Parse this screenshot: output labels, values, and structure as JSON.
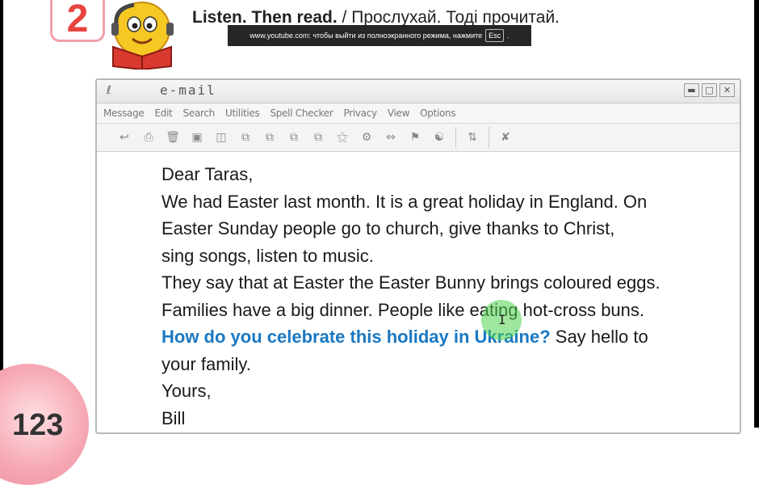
{
  "task": {
    "number": "2",
    "title_en": "Listen. Then read.",
    "separator": "/",
    "title_ua": "Прослухай. Тоді прочитай."
  },
  "toast": {
    "text_before": "www.youtube.com: чтобы выйти из полноэкранного режима, нажмите",
    "key": "Esc",
    "text_after": "."
  },
  "window": {
    "title": "e-mail",
    "menu": [
      "Message",
      "Edit",
      "Search",
      "Utilities",
      "Spell Checker",
      "Privacy",
      "View",
      "Options"
    ],
    "toolbar_icons": [
      "reply-icon",
      "print-icon",
      "trash-icon",
      "save-icon",
      "attach-icon",
      "copy-icon",
      "forward-icon",
      "folder-icon",
      "address-book-icon",
      "filter-icon",
      "sort-icon",
      "mark-icon",
      "flag-icon",
      "translate-icon",
      "delete-icon"
    ]
  },
  "email": {
    "lines": [
      "Dear Taras,",
      "We had Easter last month. It is a great holiday in England. On",
      "Easter Sunday people go to church, give thanks to Christ,",
      "sing songs, listen to music.",
      "They say that at Easter the Easter Bunny brings coloured eggs.",
      "Families have a big dinner. People like eating hot-cross buns."
    ],
    "question": "How do you celebrate this holiday in Ukraine?",
    "question_rest": " Say hello to",
    "after_question": "your family.",
    "closing": "Yours,",
    "signature": "Bill"
  },
  "page": {
    "number": "123"
  },
  "colors": {
    "accent_red": "#e8433f",
    "question_blue": "#1a78c2"
  }
}
